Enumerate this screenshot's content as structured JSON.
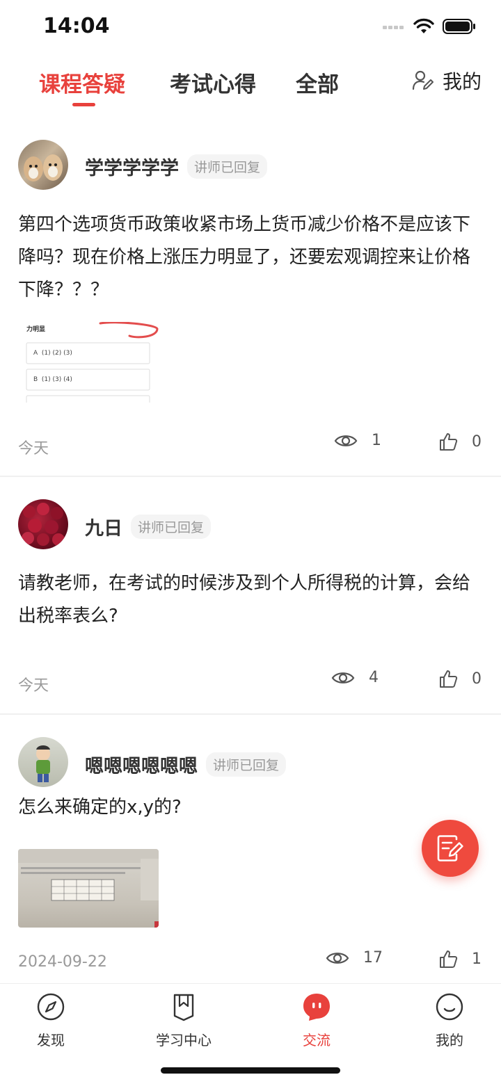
{
  "status": {
    "time": "14:04"
  },
  "tabs": [
    {
      "label": "课程答疑",
      "active": true
    },
    {
      "label": "考试心得",
      "active": false
    },
    {
      "label": "全部",
      "active": false
    }
  ],
  "header": {
    "mine_label": "我的"
  },
  "posts": [
    {
      "author": "学学学学学",
      "badge": "讲师已回复",
      "content": "第四个选项货币政策收紧市场上货币减少价格不是应该下降吗？现在价格上涨压力明显了，还要宏观调控来让价格下降？？？",
      "image_text": {
        "title": "力明显",
        "options": [
          "A  (1) (2) (3)",
          "B  (1) (3) (4)"
        ]
      },
      "date": "今天",
      "views": "1",
      "likes": "0"
    },
    {
      "author": "九日",
      "badge": "讲师已回复",
      "content": "请教老师，在考试的时候涉及到个人所得税的计算，会给出税率表么?",
      "date": "今天",
      "views": "4",
      "likes": "0"
    },
    {
      "author": "嗯嗯嗯嗯嗯嗯",
      "badge": "讲师已回复",
      "content": "怎么来确定的x,y的?",
      "date": "2024-09-22",
      "views": "17",
      "likes": "1"
    }
  ],
  "tabbar": [
    {
      "label": "发现",
      "icon": "compass-icon"
    },
    {
      "label": "学习中心",
      "icon": "book-icon"
    },
    {
      "label": "交流",
      "icon": "chat-icon",
      "active": true
    },
    {
      "label": "我的",
      "icon": "smile-icon"
    }
  ],
  "colors": {
    "accent": "#e8413c",
    "text": "#222222",
    "muted": "#999999"
  }
}
